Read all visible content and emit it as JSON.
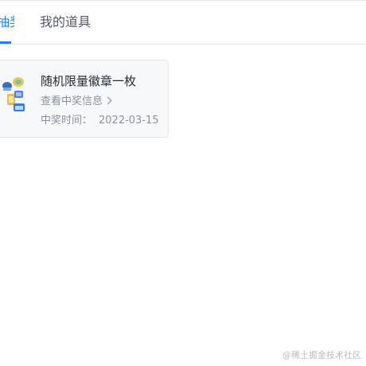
{
  "tabs": {
    "active_label": "抽奖活动",
    "inactive_label": "我的道具",
    "accent_color": "#1e80ff"
  },
  "reward_card": {
    "title": "随机限量徽章一枚",
    "link_label": "查看中奖信息",
    "link_icon": "chevron-right-icon",
    "date_label": "中奖时间：",
    "date_value": "2022-03-15",
    "thumbnail_icon": "badge-pack-icon"
  },
  "watermark": {
    "text": "@稀土掘金技术社区"
  }
}
